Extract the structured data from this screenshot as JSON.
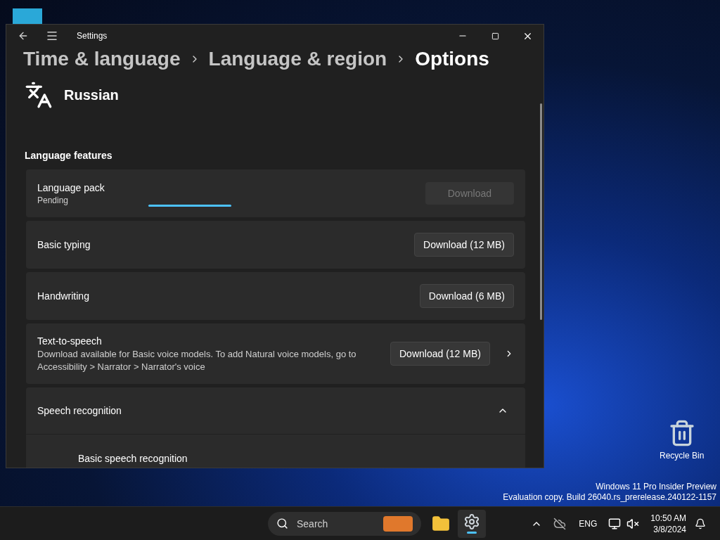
{
  "window": {
    "title": "Settings"
  },
  "breadcrumb": [
    {
      "label": "Time & language",
      "current": false
    },
    {
      "label": "Language & region",
      "current": false
    },
    {
      "label": "Options",
      "current": true
    }
  ],
  "language": {
    "name": "Russian"
  },
  "section_title": "Language features",
  "features": [
    {
      "kind": "progress",
      "title": "Language pack",
      "subtitle": "Pending",
      "level": 0.3,
      "button": "Download",
      "disabled": true
    },
    {
      "kind": "plain",
      "title": "Basic typing",
      "button": "Download (12 MB)",
      "disabled": false
    },
    {
      "kind": "plain",
      "title": "Handwriting",
      "button": "Download (6 MB)",
      "disabled": false
    },
    {
      "kind": "link",
      "title": "Text-to-speech",
      "subtitle": "Download available for Basic voice models. To add Natural voice models, go to Accessibility > Narrator > Narrator's voice",
      "button": "Download (12 MB)",
      "disabled": false
    },
    {
      "kind": "expander",
      "title": "Speech recognition",
      "expanded": true,
      "children": [
        "Basic speech recognition"
      ]
    }
  ],
  "desktop": {
    "icon_label": "Recycle Bin",
    "watermark": [
      "Windows 11 Pro Insider Preview",
      "Evaluation copy. Build 26040.rs_prerelease.240122-1157"
    ]
  },
  "taskbar": {
    "search_placeholder": "Search",
    "language": "ENG",
    "time": "10:50 AM",
    "date": "3/8/2024"
  }
}
